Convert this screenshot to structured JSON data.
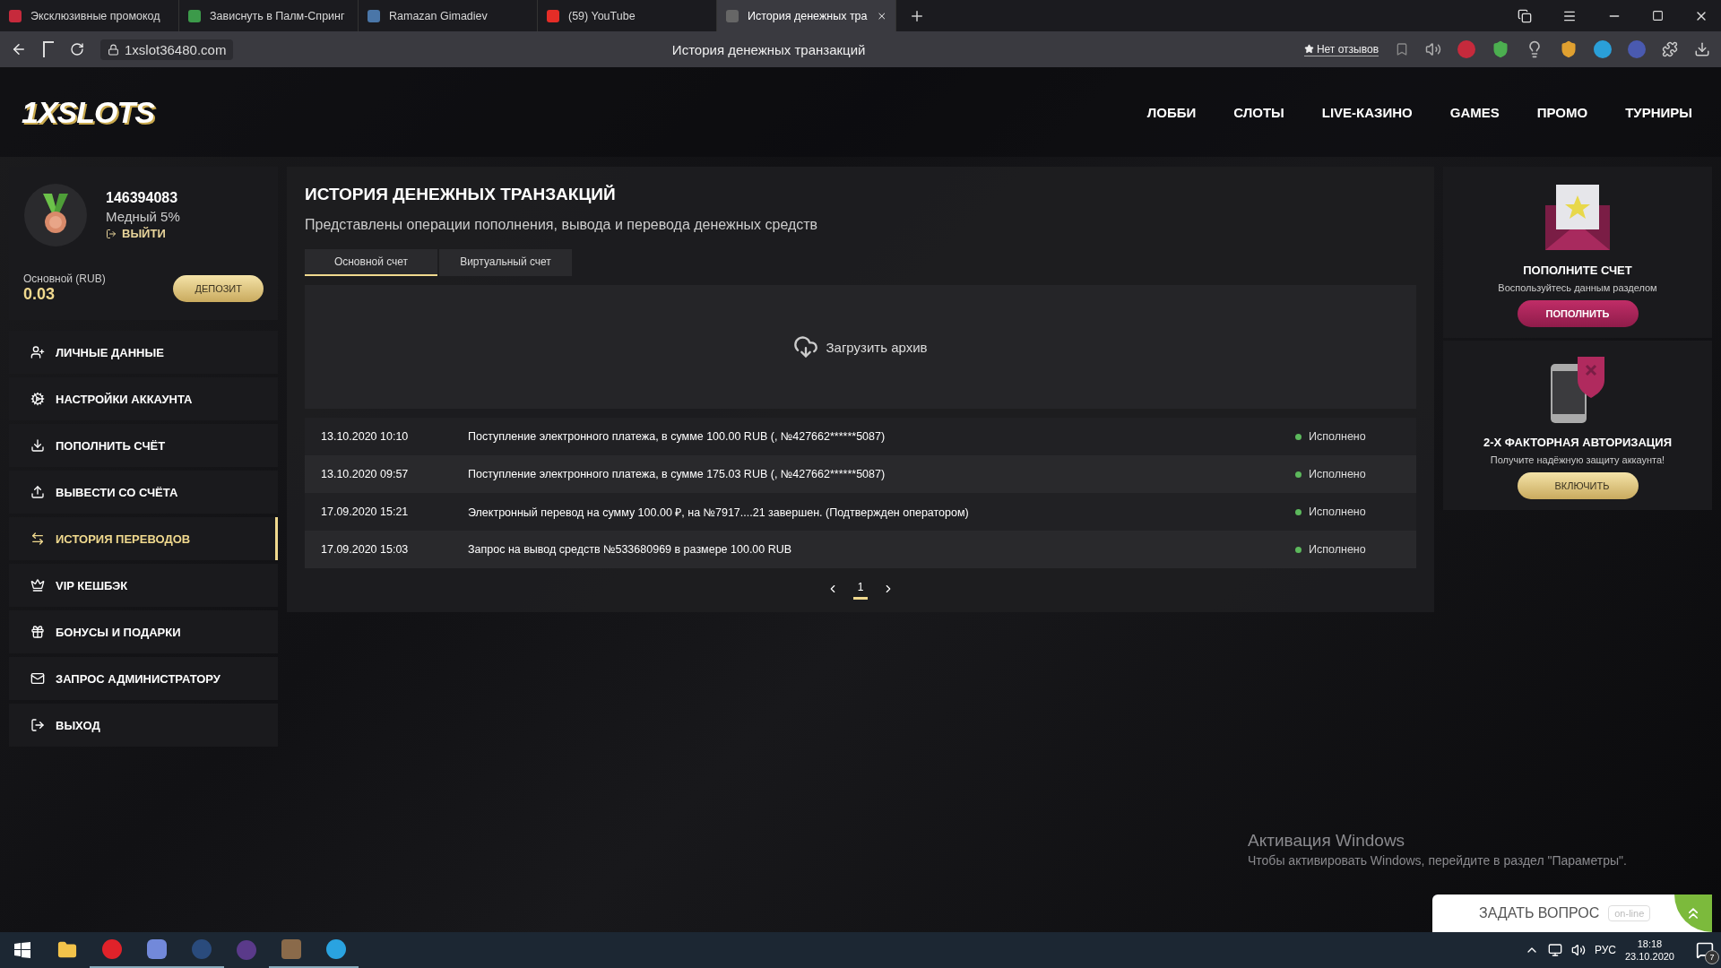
{
  "browser": {
    "tabs": [
      {
        "title": "Эксклюзивные промокод",
        "selected": false
      },
      {
        "title": "Зависнуть в Палм-Спринг",
        "selected": false
      },
      {
        "title": "Ramazan Gimadiev",
        "selected": false
      },
      {
        "title": "(59) YouTube",
        "selected": false
      },
      {
        "title": "История денежных тра",
        "selected": true
      }
    ],
    "url": "1xslot36480.com",
    "page_title": "История денежных транзакций",
    "reviews": "Нет отзывов"
  },
  "site": {
    "logo": "1XSLOTS",
    "nav": [
      "ЛОББИ",
      "СЛОТЫ",
      "LIVE-КАЗИНО",
      "GAMES",
      "ПРОМО",
      "ТУРНИРЫ"
    ]
  },
  "profile": {
    "id": "146394083",
    "level": "Медный 5%",
    "logout": "ВЫЙТИ",
    "balance_label": "Основной (RUB)",
    "balance": "0.03",
    "deposit": "ДЕПОЗИТ"
  },
  "menu": [
    {
      "label": "ЛИЧНЫЕ ДАННЫЕ",
      "selected": false
    },
    {
      "label": "НАСТРОЙКИ АККАУНТА",
      "selected": false
    },
    {
      "label": "ПОПОЛНИТЬ СЧЁТ",
      "selected": false
    },
    {
      "label": "ВЫВЕСТИ СО СЧЁТА",
      "selected": false
    },
    {
      "label": "ИСТОРИЯ ПЕРЕВОДОВ",
      "selected": true
    },
    {
      "label": "VIP КЕШБЭК",
      "selected": false
    },
    {
      "label": "БОНУСЫ И ПОДАРКИ",
      "selected": false
    },
    {
      "label": "ЗАПРОС АДМИНИСТРАТОРУ",
      "selected": false
    },
    {
      "label": "ВЫХОД",
      "selected": false
    }
  ],
  "main": {
    "title": "ИСТОРИЯ ДЕНЕЖНЫХ ТРАНЗАКЦИЙ",
    "subtitle": "Представлены операции пополнения, вывода и перевода денежных средств",
    "tabs": [
      {
        "label": "Основной счет",
        "selected": true
      },
      {
        "label": "Виртуальный счет",
        "selected": false
      }
    ],
    "download": "Загрузить архив",
    "rows": [
      {
        "date": "13.10.2020 10:10",
        "description": "Поступление электронного платежа, в сумме 100.00 RUB (, №427662******5087)",
        "status": "Исполнено"
      },
      {
        "date": "13.10.2020 09:57",
        "description": "Поступление электронного платежа, в сумме 175.03 RUB (, №427662******5087)",
        "status": "Исполнено"
      },
      {
        "date": "17.09.2020 15:21",
        "description": "Электронный перевод на сумму 100.00 ₽, на №7917....21 завершен. (Подтвержден оператором)",
        "status": "Исполнено"
      },
      {
        "date": "17.09.2020 15:03",
        "description": "Запрос на вывод средств №533680969 в размере 100.00 RUB",
        "status": "Исполнено"
      }
    ],
    "pages": [
      {
        "label": "1",
        "selected": true
      }
    ]
  },
  "promos": [
    {
      "kind": "deposit",
      "title": "ПОПОЛНИТЕ СЧЕТ",
      "text": "Воспользуйтесь данным разделом",
      "button": "ПОПОЛНИТЬ"
    },
    {
      "kind": "twofactor",
      "title": "2-Х ФАКТОРНАЯ АВТОРИЗАЦИЯ",
      "text": "Получите надёжную защиту аккаунта!",
      "button": "ВКЛЮЧИТЬ"
    }
  ],
  "windows_notice": {
    "title": "Активация Windows",
    "text": "Чтобы активировать Windows, перейдите в раздел \"Параметры\"."
  },
  "chat": {
    "label": "ЗАДАТЬ ВОПРОС",
    "status": "on-line"
  },
  "taskbar": {
    "language": "РУС",
    "time": "18:18",
    "date": "23.10.2020",
    "notifications": "7"
  }
}
